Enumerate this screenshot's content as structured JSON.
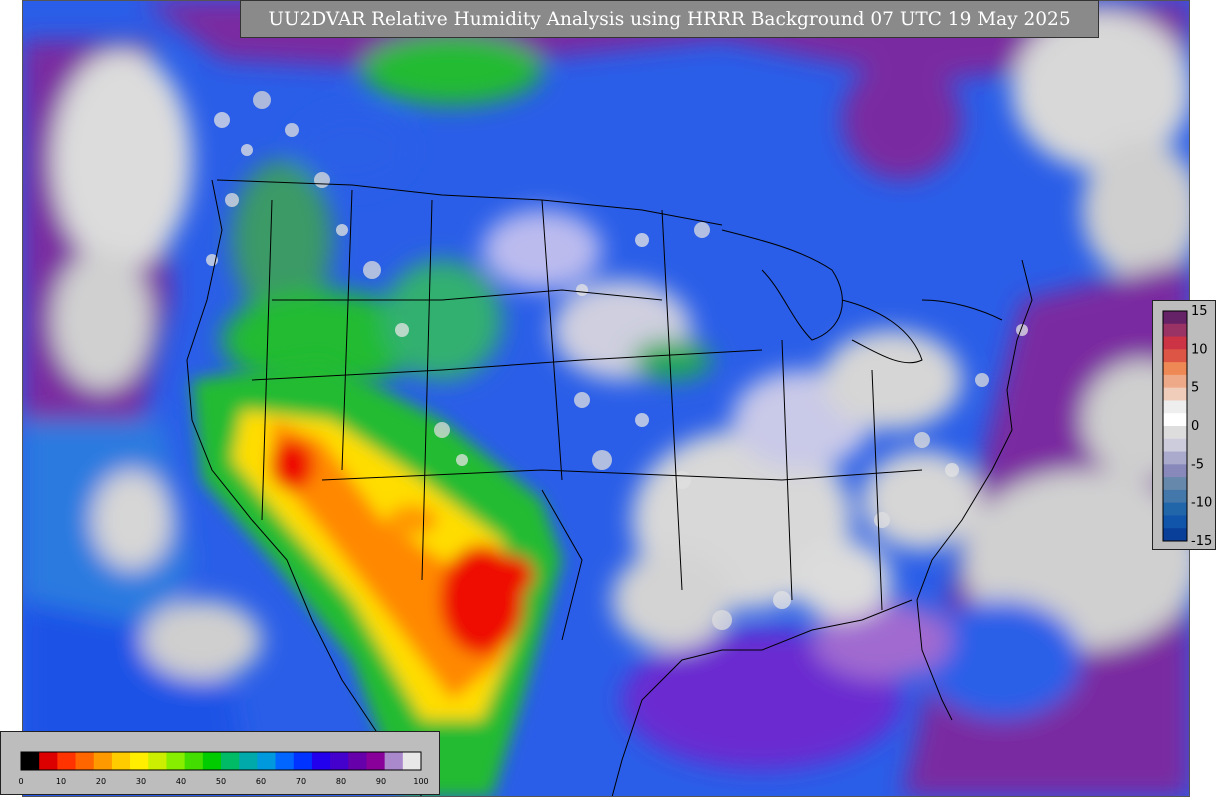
{
  "title": "UU2DVAR Relative Humidity Analysis using HRRR Background 07 UTC 19 May 2025",
  "colorbar": {
    "ticks": [
      "0",
      "10",
      "20",
      "30",
      "40",
      "50",
      "60",
      "70",
      "80",
      "90",
      "100"
    ],
    "colors": [
      "#000000",
      "#dd0000",
      "#ff3300",
      "#ff6600",
      "#ff9900",
      "#ffcc00",
      "#ffee00",
      "#ccee00",
      "#88ee00",
      "#44dd00",
      "#00cc00",
      "#00bb66",
      "#00aaaa",
      "#0099dd",
      "#0066ff",
      "#0033ff",
      "#2200ee",
      "#4400cc",
      "#6600aa",
      "#880099",
      "#aa88cc",
      "#e8e8e8"
    ]
  },
  "increment_bar": {
    "ticks": [
      "15",
      "10",
      "5",
      "0",
      "-5",
      "-10",
      "-15"
    ],
    "colors": [
      "#662266",
      "#993366",
      "#cc3344",
      "#dd5544",
      "#ee8855",
      "#eeaa88",
      "#f0ccbb",
      "#eeeeee",
      "#ffffff",
      "#dddddd",
      "#ccccdd",
      "#aaaacc",
      "#8888bb",
      "#6688aa",
      "#4477aa",
      "#2266aa",
      "#1155aa",
      "#0a3f99"
    ]
  },
  "map": {
    "colors": {
      "blue": "#2060e0",
      "purple": "#7a2aa0",
      "gray": "#d4d4d4",
      "green": "#22bb33",
      "yellow": "#ffdd00",
      "orange": "#ff8800",
      "red": "#ee1100"
    }
  }
}
